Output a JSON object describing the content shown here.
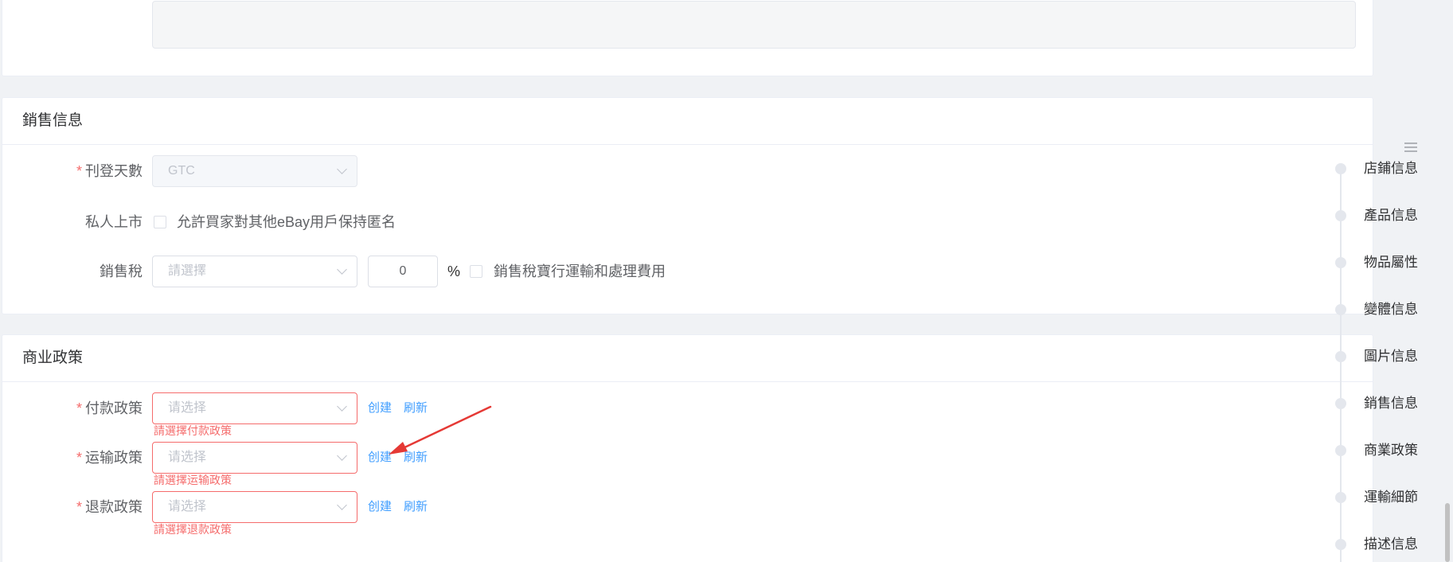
{
  "sales": {
    "title": "銷售信息",
    "listing_days": {
      "label": "刊登天數",
      "value": "GTC"
    },
    "private_listing": {
      "label": "私人上市",
      "checkbox_label": "允許買家對其他eBay用戶保持匿名"
    },
    "sales_tax": {
      "label": "銷售稅",
      "select_placeholder": "請選擇",
      "rate_value": "0",
      "unit": "%",
      "checkbox_label": "銷售稅寶行運輸和處理費用"
    }
  },
  "policy": {
    "title": "商业政策",
    "rows": [
      {
        "label": "付款政策",
        "placeholder": "请选择",
        "create": "创建",
        "refresh": "刷新",
        "error": "請選擇付款政策"
      },
      {
        "label": "运输政策",
        "placeholder": "请选择",
        "create": "创建",
        "refresh": "刷新",
        "error": "請選擇运输政策"
      },
      {
        "label": "退款政策",
        "placeholder": "请选择",
        "create": "创建",
        "refresh": "刷新",
        "error": "請選擇退款政策"
      }
    ]
  },
  "required_mark": "*",
  "anchor_nav": {
    "items": [
      "店鋪信息",
      "產品信息",
      "物品屬性",
      "變體信息",
      "圖片信息",
      "銷售信息",
      "商業政策",
      "運輸細節",
      "描述信息"
    ]
  },
  "colors": {
    "accent": "#409eff",
    "error": "#f56c6c",
    "annotation_arrow": "#e53935"
  }
}
